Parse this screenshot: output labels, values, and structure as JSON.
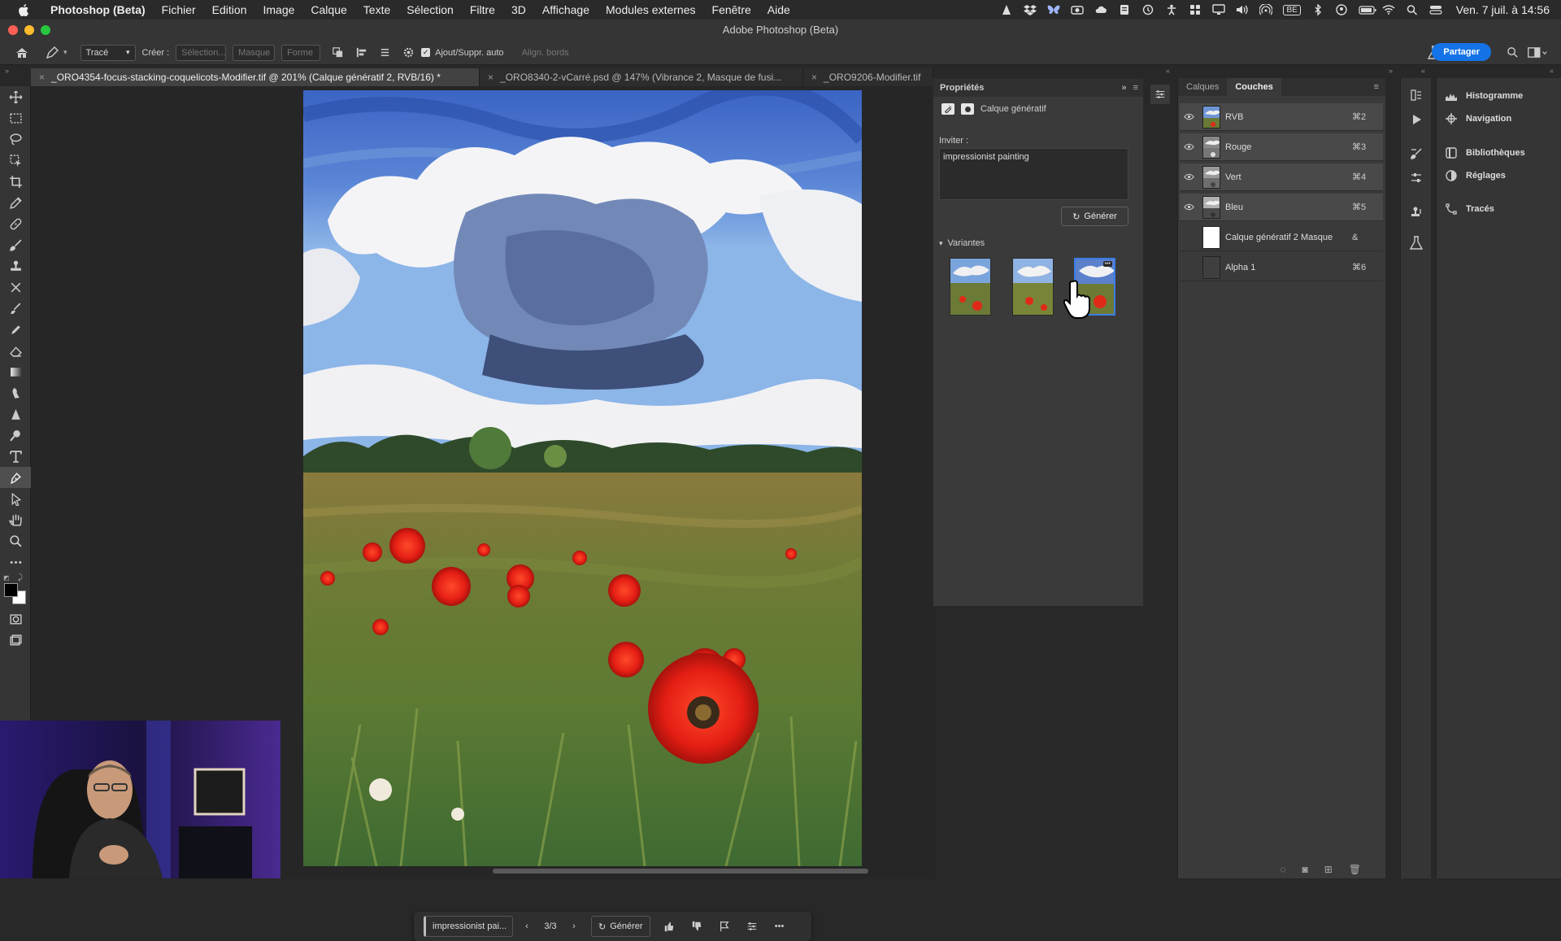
{
  "menubar": {
    "app": "Photoshop (Beta)",
    "items": [
      "Fichier",
      "Edition",
      "Image",
      "Calque",
      "Texte",
      "Sélection",
      "Filtre",
      "3D",
      "Affichage",
      "Modules externes",
      "Fenêtre",
      "Aide"
    ],
    "keyboard_badge": "BE",
    "clock": "Ven. 7 juil. à 14:56"
  },
  "window": {
    "title": "Adobe Photoshop (Beta)"
  },
  "options_bar": {
    "tool_mode": "Tracé",
    "create_label": "Créer :",
    "selection_btn": "Sélection...",
    "mask_btn": "Masque",
    "shape_btn": "Forme",
    "auto_add": "Ajout/Suppr. auto",
    "align_edges": "Align. bords",
    "share": "Partager"
  },
  "doc_tabs": [
    "_ORO4354-focus-stacking-coquelicots-Modifier.tif @ 201% (Calque génératif 2, RVB/16) *",
    "_ORO8340-2-vCarré.psd @ 147% (Vibrance 2, Masque de fusi...",
    "_ORO9206-Modifier.tif"
  ],
  "properties": {
    "title": "Propriétés",
    "layer_type": "Calque génératif",
    "prompt_label": "Inviter :",
    "prompt_value": "impressionist painting",
    "generate": "Générer",
    "variants_label": "Variantes"
  },
  "contextual_bar": {
    "prompt": "impressionist pai...",
    "counter": "3/3",
    "generate": "Générer"
  },
  "channels_panel": {
    "tabs": [
      "Calques",
      "Couches"
    ],
    "active_tab": "Couches",
    "channels": [
      {
        "name": "RVB",
        "shortcut": "⌘2"
      },
      {
        "name": "Rouge",
        "shortcut": "⌘3"
      },
      {
        "name": "Vert",
        "shortcut": "⌘4"
      },
      {
        "name": "Bleu",
        "shortcut": "⌘5"
      },
      {
        "name": "Calque génératif 2 Masque",
        "shortcut": "&"
      },
      {
        "name": "Alpha 1",
        "shortcut": "⌘6"
      }
    ]
  },
  "collapsed_panels": [
    "Histogramme",
    "Navigation",
    "Bibliothèques",
    "Réglages",
    "Tracés"
  ],
  "colors": {
    "accent": "#1473e6",
    "selected_border": "#3a7de6",
    "panel_bg": "#3a3a3a"
  }
}
